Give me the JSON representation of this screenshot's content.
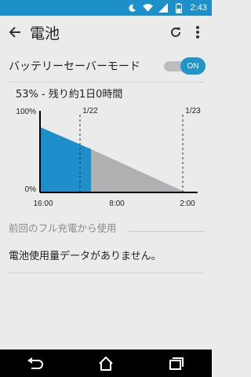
{
  "status_bar": {
    "time": "2:43",
    "icons": [
      "moon-icon",
      "wifi-icon",
      "signal-icon",
      "battery-icon"
    ]
  },
  "app_bar": {
    "title": "電池",
    "back_icon": "arrow-back-icon",
    "refresh_icon": "refresh-icon",
    "more_icon": "more-vert-icon"
  },
  "battery_saver": {
    "label": "バッテリーセーバーモード",
    "toggle_state": "ON",
    "accent_color": "#2196c9"
  },
  "battery_status": "53% - 残り約1日0時間",
  "chart_data": {
    "type": "area",
    "y_ticks": [
      "100%",
      "0%"
    ],
    "ylim": [
      0,
      100
    ],
    "x_ticks": [
      "16:00",
      "8:00",
      "2:00"
    ],
    "day_markers": [
      "1/22",
      "1/23"
    ],
    "series": [
      {
        "values": [
          {
            "x": "16:00",
            "y": 80
          },
          {
            "x": "now",
            "y": 53
          }
        ],
        "color": "#1e8fca"
      },
      {
        "values": [
          {
            "x": "now",
            "y": 53
          },
          {
            "x": "2:00",
            "y": 0
          }
        ],
        "color": "#aeb0b2"
      }
    ]
  },
  "history": {
    "section_header": "前回のフル充電から使用",
    "empty_message": "電池使用量データがありません。"
  },
  "nav_bar": {
    "icons": [
      "back-nav-icon",
      "home-nav-icon",
      "recents-nav-icon"
    ]
  }
}
